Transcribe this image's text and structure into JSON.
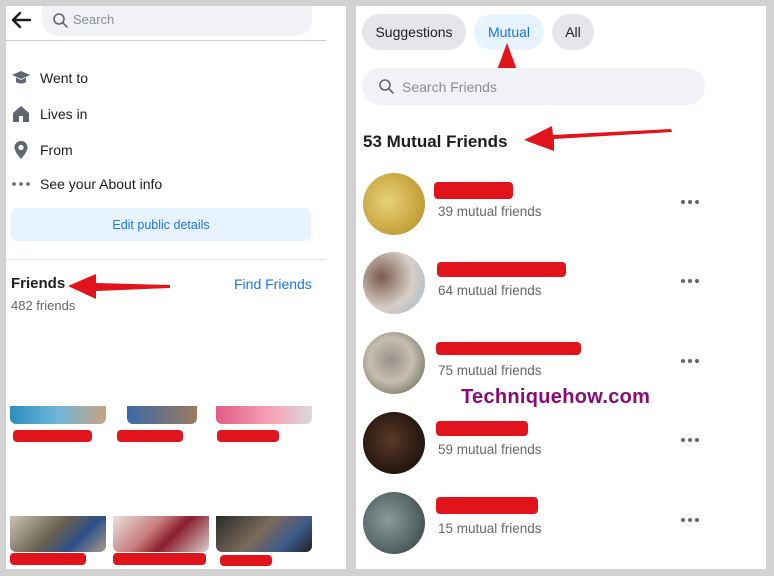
{
  "left": {
    "search": {
      "placeholder": "Search"
    },
    "about_items": [
      {
        "icon": "graduation-cap-icon",
        "label": "Went to"
      },
      {
        "icon": "home-icon",
        "label": "Lives in"
      },
      {
        "icon": "location-pin-icon",
        "label": "From"
      },
      {
        "icon": "more-horizontal-icon",
        "label": "See your About info"
      }
    ],
    "edit_button": "Edit public details",
    "friends": {
      "title": "Friends",
      "count": "482 friends",
      "find_link": "Find Friends"
    }
  },
  "right": {
    "tabs": [
      {
        "label": "Suggestions",
        "active": false
      },
      {
        "label": "Mutual",
        "active": true
      },
      {
        "label": "All",
        "active": false
      }
    ],
    "search": {
      "placeholder": "Search Friends"
    },
    "heading": "53 Mutual Friends",
    "friends": [
      {
        "mutual": "39 mutual friends"
      },
      {
        "mutual": "64 mutual friends"
      },
      {
        "mutual": "75 mutual friends"
      },
      {
        "mutual": "59 mutual friends"
      },
      {
        "mutual": "15 mutual friends"
      }
    ]
  },
  "watermark": "Techniquehow.com",
  "colors": {
    "accent": "#1877f2",
    "redaction": "#e0141a",
    "arrow": "#e0141a",
    "watermark": "#8b0a7a"
  }
}
